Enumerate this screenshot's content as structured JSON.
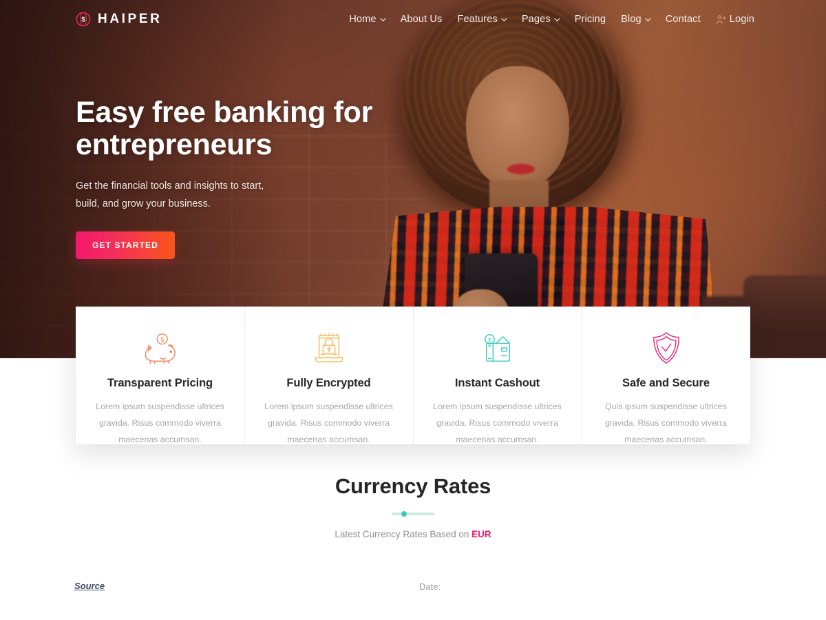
{
  "header": {
    "brand": {
      "name": "HAIPER",
      "icon": "globe-dollar-icon"
    },
    "nav": [
      {
        "label": "Home",
        "has_dropdown": true
      },
      {
        "label": "About Us",
        "has_dropdown": false
      },
      {
        "label": "Features",
        "has_dropdown": true
      },
      {
        "label": "Pages",
        "has_dropdown": true
      },
      {
        "label": "Pricing",
        "has_dropdown": false
      },
      {
        "label": "Blog",
        "has_dropdown": true
      },
      {
        "label": "Contact",
        "has_dropdown": false
      },
      {
        "label": "Login",
        "has_dropdown": false,
        "icon": "user-login-icon"
      }
    ]
  },
  "hero": {
    "title_line1": "Easy free banking for",
    "title_line2": "entrepreneurs",
    "subtitle": "Get the financial tools and insights to start, build, and grow your business.",
    "cta_label": "GET STARTED"
  },
  "features": [
    {
      "icon": "piggy-bank-icon",
      "color": "#f08354",
      "title": "Transparent Pricing",
      "text": "Lorem ipsum suspendisse ultrices gravida. Risus commodo viverra maecenas accumsan."
    },
    {
      "icon": "laptop-lock-icon",
      "color": "#f0bd5a",
      "title": "Fully Encrypted",
      "text": "Lorem ipsum suspendisse ultrices gravida. Risus commodo viverra maecenas accumsan."
    },
    {
      "icon": "wallet-cash-icon",
      "color": "#3ec9c4",
      "title": "Instant Cashout",
      "text": "Lorem ipsum suspendisse ultrices gravida. Risus commodo viverra maecenas accumsan."
    },
    {
      "icon": "shield-check-icon",
      "color": "#ea2a7b",
      "title": "Safe and Secure",
      "text": "Quis ipsum suspendisse ultrices gravida. Risus commodo viverra maecenas accumsan."
    }
  ],
  "currency": {
    "title": "Currency Rates",
    "subtitle_prefix": "Latest Currency Rates Based on ",
    "base_currency": "EUR",
    "accent_color": "#f2186b"
  },
  "table_meta": {
    "source_label": "Source",
    "date_label": "Date:"
  }
}
